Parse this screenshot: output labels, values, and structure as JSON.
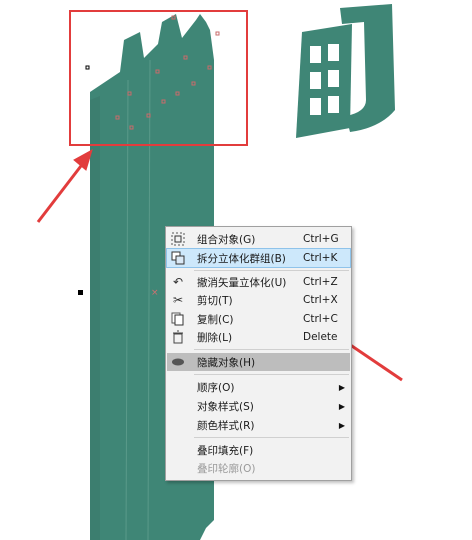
{
  "colors": {
    "shape_fill": "#3f8676",
    "highlight_red": "#e23c3c",
    "menu_bg": "#f2f2f2",
    "menu_hover": "#cde8fb",
    "menu_grey": "#bdbdbd"
  },
  "context_menu": {
    "items": [
      {
        "label": "组合对象(G)",
        "shortcut": "Ctrl+G",
        "icon": "group-icon"
      },
      {
        "label": "拆分立体化群组(B)",
        "shortcut": "Ctrl+K",
        "icon": "break-apart-icon",
        "state": "hover"
      },
      {
        "label": "撤消矢量立体化(U)",
        "shortcut": "Ctrl+Z",
        "icon": "undo-icon"
      },
      {
        "label": "剪切(T)",
        "shortcut": "Ctrl+X",
        "icon": "scissors-icon"
      },
      {
        "label": "复制(C)",
        "shortcut": "Ctrl+C",
        "icon": "copy-icon"
      },
      {
        "label": "删除(L)",
        "shortcut": "Delete",
        "icon": "trash-icon"
      },
      {
        "label": "隐藏对象(H)",
        "shortcut": "",
        "icon": "eye-icon",
        "state": "selected"
      },
      {
        "label": "顺序(O)",
        "shortcut": "",
        "submenu": true
      },
      {
        "label": "对象样式(S)",
        "shortcut": "",
        "submenu": true
      },
      {
        "label": "颜色样式(R)",
        "shortcut": "",
        "submenu": true
      },
      {
        "label": "叠印填充(F)",
        "shortcut": ""
      },
      {
        "label": "叠印轮廓(O)",
        "shortcut": "",
        "disabled": true
      }
    ]
  }
}
